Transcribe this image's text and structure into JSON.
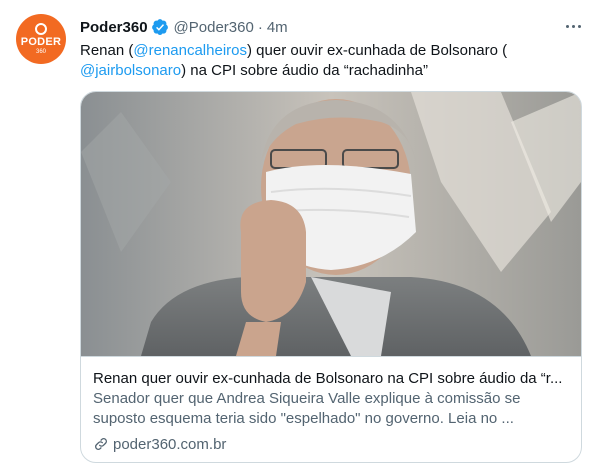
{
  "tweet": {
    "author": {
      "name": "Poder360",
      "handle": "@Poder360",
      "avatar_text": "PODER",
      "avatar_sub": "360"
    },
    "separator": "·",
    "time": "4m",
    "text": {
      "p1": "Renan (",
      "mention1": "@renancalheiros",
      "p2": ") quer ouvir ex-cunhada de Bolsonaro (",
      "mention2": "@jairbolsonaro",
      "p3": ") na CPI sobre áudio da “rachadinha”"
    },
    "card": {
      "title": "Renan quer ouvir ex-cunhada de Bolsonaro na CPI sobre áudio da “r...",
      "description": "Senador quer que Andrea Siqueira Valle explique à comissão se suposto esquema teria sido \"espelhado\" no governo. Leia no ...",
      "domain": "poder360.com.br"
    }
  },
  "icons": {
    "verified": "verified-badge-icon",
    "more": "more-options-icon",
    "link": "link-icon"
  },
  "colors": {
    "accent": "#1d9bf0",
    "brand": "#f26a22",
    "secondary_text": "#536471",
    "border": "#cfd9de"
  }
}
